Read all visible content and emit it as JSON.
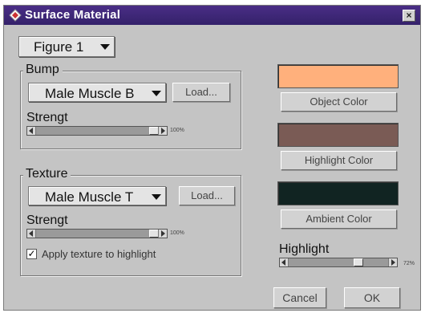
{
  "window": {
    "title": "Surface Material",
    "close_glyph": "×"
  },
  "figure_select": {
    "value": "Figure 1"
  },
  "bump": {
    "label": "Bump",
    "map_select": "Male Muscle B",
    "load_label": "Load...",
    "strength_label": "Strengt",
    "strength_value_text": "100%",
    "strength_level": 1.0
  },
  "texture": {
    "label": "Texture",
    "map_select": "Male Muscle T",
    "load_label": "Load...",
    "strength_label": "Strengt",
    "strength_value_text": "100%",
    "strength_level": 1.0,
    "apply_checkbox": {
      "checked": true,
      "label": "Apply texture to highlight",
      "check_glyph": "✓"
    }
  },
  "colors": {
    "object": {
      "label": "Object Color",
      "hex": "#ffb07c"
    },
    "highlight": {
      "label": "Highlight Color",
      "hex": "#7a5b55"
    },
    "ambient": {
      "label": "Ambient Color",
      "hex": "#112422"
    }
  },
  "highlight_slider": {
    "label": "Highlight",
    "value_text": "72%",
    "level": 0.72
  },
  "buttons": {
    "cancel": "Cancel",
    "ok": "OK"
  },
  "icons": {
    "title": "app-diamond-icon",
    "close": "close-icon"
  }
}
